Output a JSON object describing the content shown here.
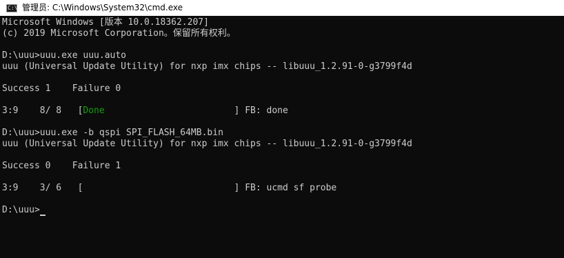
{
  "window": {
    "title": "管理员: C:\\Windows\\System32\\cmd.exe",
    "icon": "cmd-prompt-icon",
    "icon_glyph": "C:\\_"
  },
  "colors": {
    "background": "#0c0c0c",
    "text": "#cccccc",
    "done_green": "#13a10e"
  },
  "console": {
    "line1": "Microsoft Windows [版本 10.0.18362.207]",
    "line2": "(c) 2019 Microsoft Corporation。保留所有权利。",
    "prompt1": "D:\\uuu>uuu.exe uuu.auto",
    "info1": "uuu (Universal Update Utility) for nxp imx chips -- libuuu_1.2.91-0-g3799f4d",
    "result1": "Success 1    Failure 0",
    "progress1_pre": "3:9    8/ 8   [",
    "progress1_status": "Done",
    "progress1_post": "                        ] FB: done",
    "prompt2": "D:\\uuu>uuu.exe -b qspi SPI_FLASH_64MB.bin",
    "info2": "uuu (Universal Update Utility) for nxp imx chips -- libuuu_1.2.91-0-g3799f4d",
    "result2": "Success 0    Failure 1",
    "progress2": "3:9    3/ 6   [                            ] FB: ucmd sf probe",
    "prompt3": "D:\\uuu>"
  }
}
